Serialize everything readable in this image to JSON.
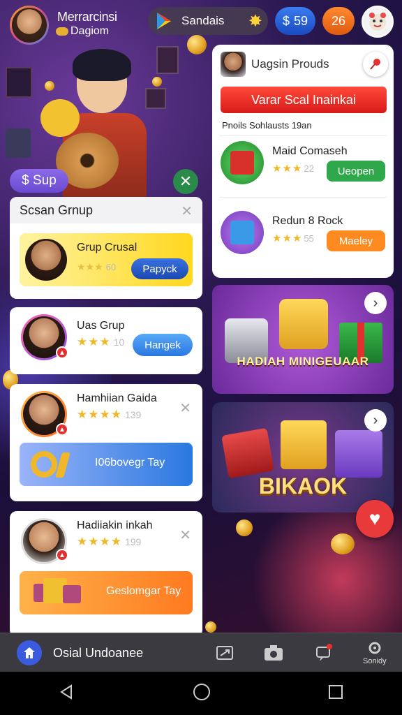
{
  "topbar": {
    "username": "Merrarcinsi",
    "subtitle": "Dagiom",
    "store_label": "Sandais",
    "money": "59",
    "currency_symbol": "$",
    "level": "26"
  },
  "hero": {
    "sup_label": "$ Sup"
  },
  "group_card": {
    "title": "Scsan Grnup",
    "item_title": "Grup Crusal",
    "rating_num": "60",
    "button": "Papyck"
  },
  "row1": {
    "title": "Uas Grup",
    "rating_num": "10",
    "button": "Hangek"
  },
  "row2": {
    "title": "Hamhiian Gaida",
    "rating_num": "139",
    "bar_text": "I06bovegr Tay"
  },
  "row3": {
    "title": "Hadiiakin inkah",
    "rating_num": "199",
    "bar_text": "Geslomgar Tay"
  },
  "right_panel": {
    "header": "Uagsin Prouds",
    "red_button": "Varar Scal Inainkai",
    "subtitle": "Pnoils Sohlausts 19an",
    "items": [
      {
        "title": "Maid Comaseh",
        "rating_num": "22",
        "button": "Ueopen",
        "button_color": "#2ea84a"
      },
      {
        "title": "Redun 8 Rock",
        "rating_num": "55",
        "button": "Maeley",
        "button_color": "#ff8a20"
      }
    ]
  },
  "banners": {
    "banner1_text": "HADIAH MINIGEUAAR",
    "banner2_text": "BIKAOK"
  },
  "bottom_nav": {
    "home_label": "Osial Undoanee",
    "settings_label": "Sonidy"
  },
  "colors": {
    "accent": "#3a5ae0",
    "red": "#e83a3a",
    "gold": "#f0b828"
  }
}
